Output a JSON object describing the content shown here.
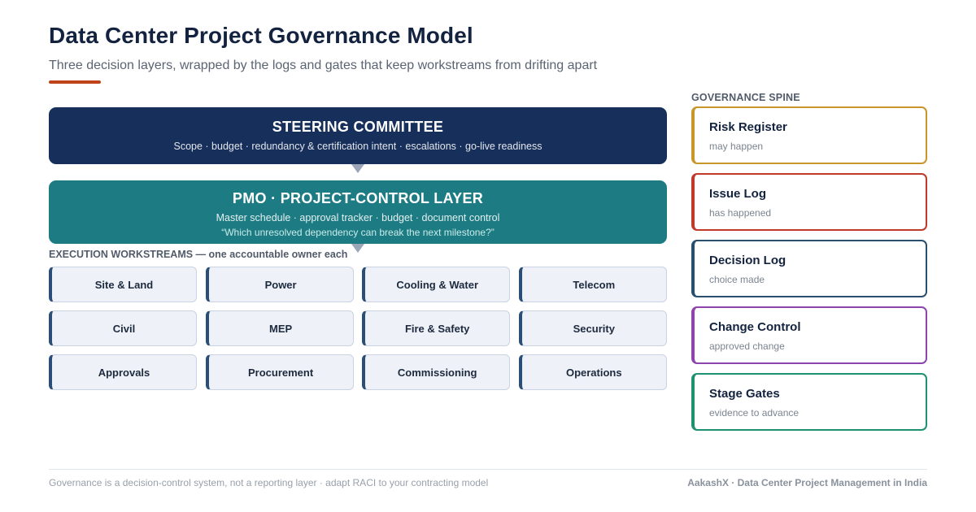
{
  "header": {
    "title": "Data Center Project Governance Model",
    "subtitle": "Three decision layers, wrapped by the logs and gates that keep workstreams from drifting apart",
    "accent_color": "#c0441a"
  },
  "layers": {
    "steering": {
      "title": "STEERING COMMITTEE",
      "subtitle": "Scope · budget · redundancy & certification intent · escalations · go-live readiness",
      "color": "#172f5b"
    },
    "pmo": {
      "title": "PMO · PROJECT-CONTROL LAYER",
      "subtitle": "Master schedule · approval tracker · budget · document control",
      "quote": "“Which unresolved dependency can break the next milestone?”",
      "color": "#1d7c83"
    }
  },
  "workstreams": {
    "heading": "EXECUTION WORKSTREAMS — one accountable owner each",
    "items": [
      "Site & Land",
      "Power",
      "Cooling & Water",
      "Telecom",
      "Civil",
      "MEP",
      "Fire & Safety",
      "Security",
      "Approvals",
      "Procurement",
      "Commissioning",
      "Operations"
    ]
  },
  "spine": {
    "heading": "GOVERNANCE SPINE",
    "cards": [
      {
        "title": "Risk Register",
        "subtitle": "may happen",
        "color": "#c9962a"
      },
      {
        "title": "Issue Log",
        "subtitle": "has happened",
        "color": "#c0392b"
      },
      {
        "title": "Decision Log",
        "subtitle": "choice made",
        "color": "#2a4e6e"
      },
      {
        "title": "Change Control",
        "subtitle": "approved change",
        "color": "#8e44ad"
      },
      {
        "title": "Stage Gates",
        "subtitle": "evidence to advance",
        "color": "#1f9173"
      }
    ]
  },
  "footer": {
    "left": "Governance is a decision-control system, not a reporting layer · adapt RACI to your contracting model",
    "right": "AakashX · Data Center Project Management in India"
  }
}
